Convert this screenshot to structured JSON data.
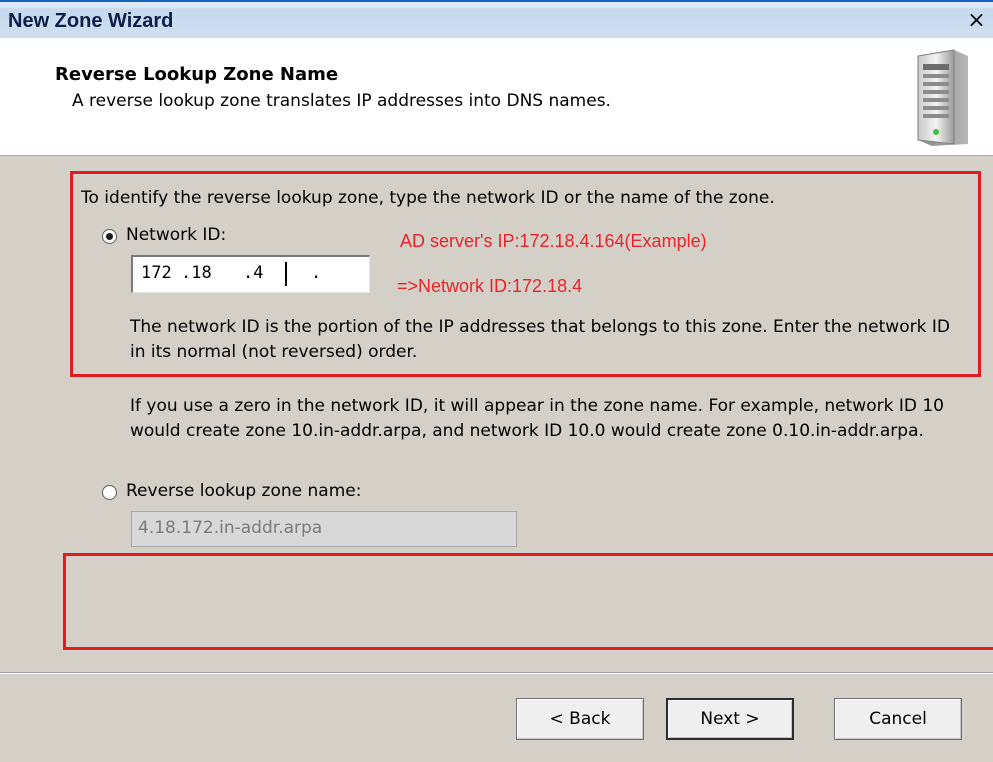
{
  "window": {
    "title": "New Zone Wizard",
    "close_glyph": "×"
  },
  "header": {
    "title": "Reverse Lookup Zone Name",
    "subtitle": "A reverse lookup zone translates IP addresses into DNS names.",
    "icon": "server-icon"
  },
  "content": {
    "intro": "To identify the reverse lookup zone, type the network ID or the name of the zone.",
    "network_id_label": "Network ID:",
    "network_id_selected": true,
    "network_id_octets": [
      "172",
      ".18",
      ".4",
      "."
    ],
    "network_id_note": "The network ID is the portion of the IP addresses that belongs to this zone. Enter the network ID in its normal (not reversed) order.",
    "zero_note": "If you use a zero in the network ID, it will appear in the zone name. For example, network ID 10 would create zone 10.in-addr.arpa, and network ID 10.0 would create zone 0.10.in-addr.arpa.",
    "zone_name_label": "Reverse lookup zone name:",
    "zone_name_selected": false,
    "zone_name_value": "4.18.172.in-addr.arpa"
  },
  "annotations": {
    "server_ip": "AD server's IP:172.18.4.164(Example)",
    "network_id": "=>Network ID:172.18.4",
    "color": "#e11b22"
  },
  "buttons": {
    "back": "< Back",
    "next": "Next >",
    "cancel": "Cancel"
  }
}
